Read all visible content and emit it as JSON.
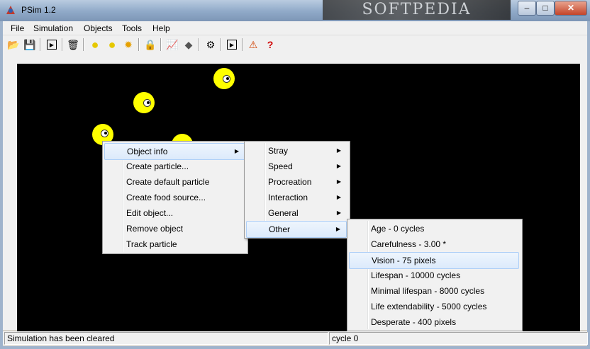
{
  "window": {
    "title": "PSim 1.2",
    "watermark": "SOFTPEDIA"
  },
  "menubar": [
    "File",
    "Simulation",
    "Objects",
    "Tools",
    "Help"
  ],
  "toolbar": [
    {
      "name": "open-icon",
      "glyph": "📂"
    },
    {
      "name": "save-icon",
      "glyph": "💾"
    },
    {
      "name": "run-icon",
      "glyph": "▶"
    },
    {
      "name": "delete-icon",
      "glyph": "🗑"
    },
    {
      "name": "particle-icon",
      "glyph": "●"
    },
    {
      "name": "default-particle-icon",
      "glyph": "●"
    },
    {
      "name": "food-source-icon",
      "glyph": "✹"
    },
    {
      "name": "lock-icon",
      "glyph": "🔒"
    },
    {
      "name": "graph-icon",
      "glyph": "📈"
    },
    {
      "name": "eraser-icon",
      "glyph": "◆"
    },
    {
      "name": "settings-icon",
      "glyph": "⚙"
    },
    {
      "name": "step-icon",
      "glyph": "▶"
    },
    {
      "name": "warning-icon",
      "glyph": "⚠"
    },
    {
      "name": "help-icon",
      "glyph": "?"
    }
  ],
  "context_menu": [
    {
      "label": "Object info",
      "submenu": true,
      "highlighted": true
    },
    {
      "label": "Create particle...",
      "submenu": false
    },
    {
      "label": "Create default particle",
      "submenu": false
    },
    {
      "label": "Create food source...",
      "submenu": false
    },
    {
      "label": "Edit object...",
      "submenu": false
    },
    {
      "label": "Remove object",
      "submenu": false
    },
    {
      "label": "Track particle",
      "submenu": false
    }
  ],
  "object_info_submenu": [
    {
      "label": "Stray",
      "submenu": true
    },
    {
      "label": "Speed",
      "submenu": true
    },
    {
      "label": "Procreation",
      "submenu": true
    },
    {
      "label": "Interaction",
      "submenu": true
    },
    {
      "label": "General",
      "submenu": true
    },
    {
      "label": "Other",
      "submenu": true,
      "highlighted": true
    }
  ],
  "other_submenu": [
    {
      "label": "Age - 0 cycles"
    },
    {
      "label": "Carefulness - 3.00 *"
    },
    {
      "label": "Vision - 75 pixels",
      "highlighted": true
    },
    {
      "label": "Lifespan - 10000 cycles"
    },
    {
      "label": "Minimal lifespan - 8000 cycles"
    },
    {
      "label": "Life extendability - 5000 cycles"
    },
    {
      "label": "Desperate - 400 pixels"
    }
  ],
  "statusbar": {
    "message": "Simulation has been cleared",
    "cycle": "cycle 0"
  },
  "colors": {
    "canvas": "#000000",
    "particle": "#ffff00",
    "highlight": "#dceafb"
  }
}
